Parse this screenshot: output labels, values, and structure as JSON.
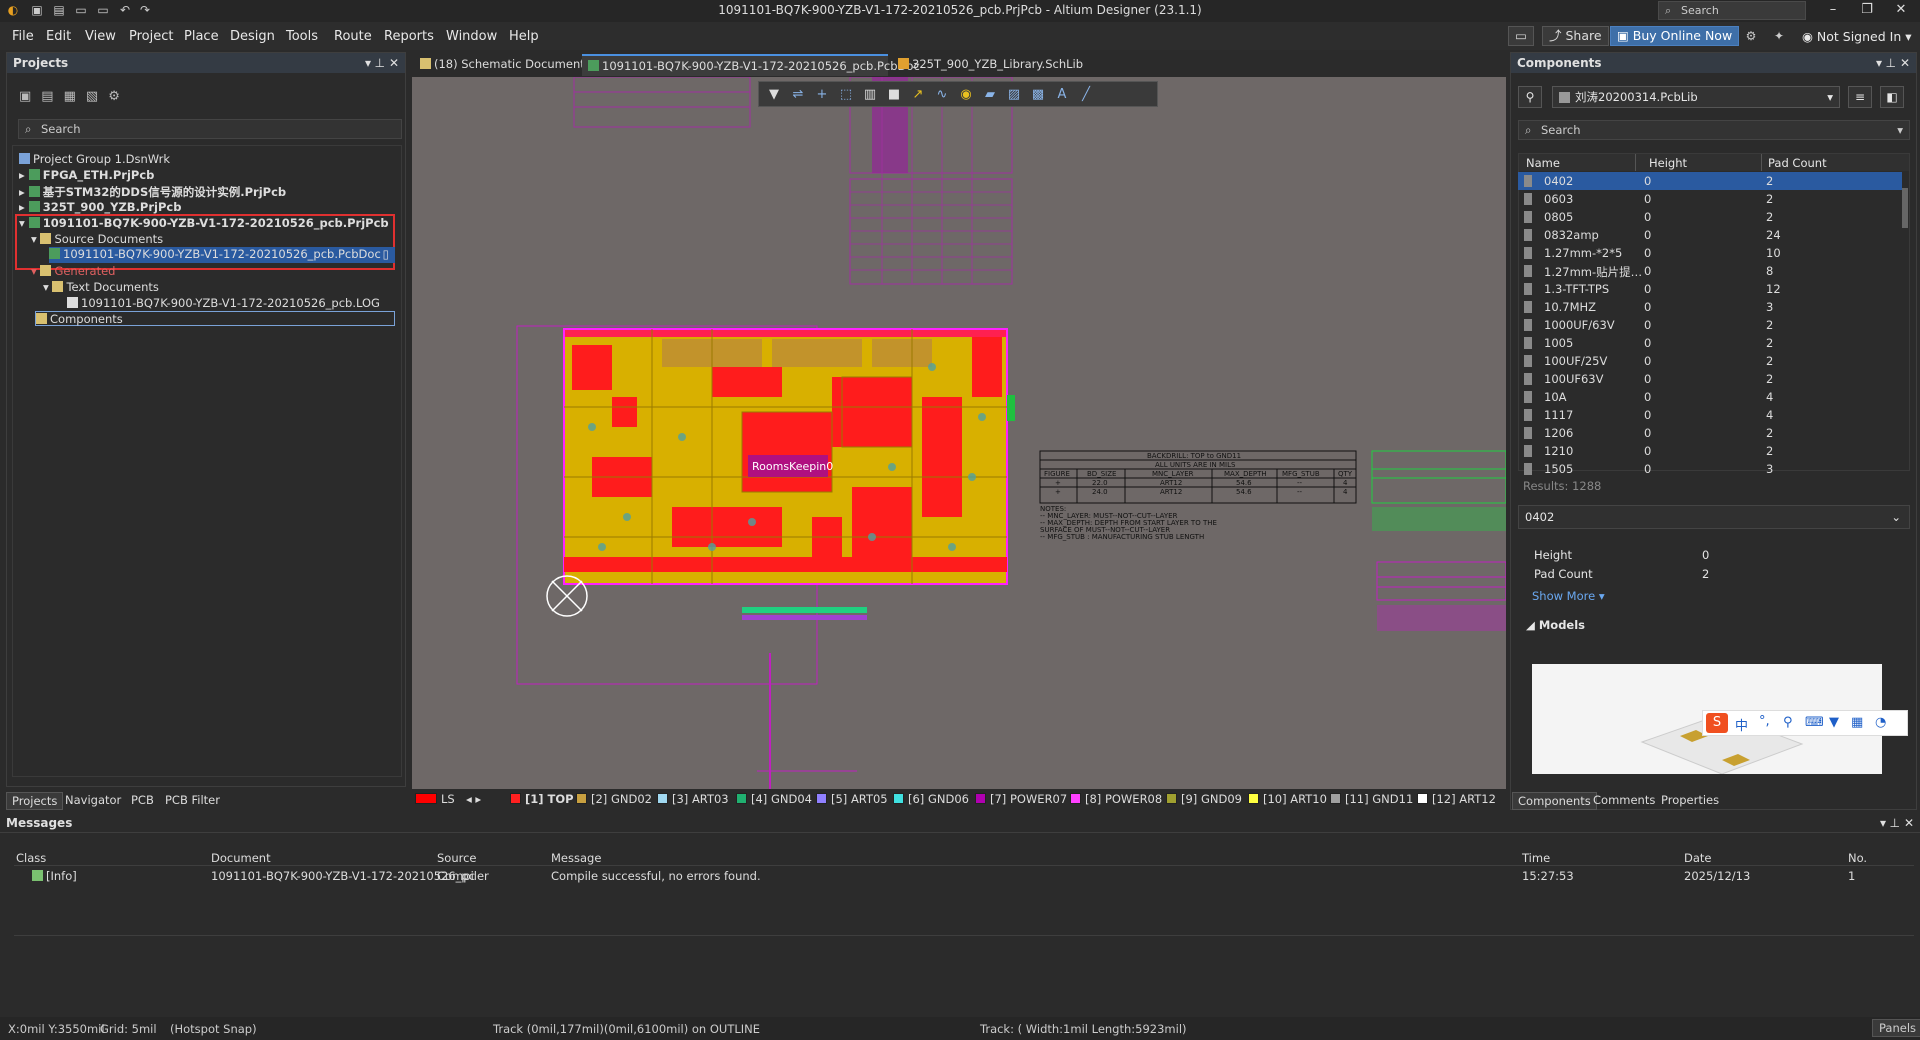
{
  "window": {
    "title": "1091101-BQ7K-900-YZB-V1-172-20210526_pcb.PrjPcb - Altium Designer (23.1.1)",
    "search_placeholder": "Search"
  },
  "menu": [
    "File",
    "Edit",
    "View",
    "Project",
    "Place",
    "Design",
    "Tools",
    "Route",
    "Reports",
    "Window",
    "Help"
  ],
  "menu_right": {
    "share": "Share",
    "buy": "Buy Online Now",
    "account": "Not Signed In"
  },
  "projects_panel": {
    "title": "Projects",
    "search_placeholder": "Search",
    "tree": [
      {
        "label": "Project Group 1.DsnWrk"
      },
      {
        "label": "FPGA_ETH.PrjPcb"
      },
      {
        "label": "基于STM32的DDS信号源的设计实例.PrjPcb"
      },
      {
        "label": "325T_900_YZB.PrjPcb"
      },
      {
        "label": "1091101-BQ7K-900-YZB-V1-172-20210526_pcb.PrjPcb"
      },
      {
        "label": "Source Documents"
      },
      {
        "label": "1091101-BQ7K-900-YZB-V1-172-20210526_pcb.PcbDoc"
      },
      {
        "label": "Generated"
      },
      {
        "label": "Text Documents"
      },
      {
        "label": "1091101-BQ7K-900-YZB-V1-172-20210526_pcb.LOG"
      },
      {
        "label": "Components"
      }
    ],
    "tabs": [
      "Projects",
      "Navigator",
      "PCB",
      "PCB Filter"
    ]
  },
  "doc_tabs": [
    "(18) Schematic Document",
    "1091101-BQ7K-900-YZB-V1-172-20210526_pcb.PcbDoc",
    "325T_900_YZB_Library.SchLib"
  ],
  "canvas": {
    "room_label": "RoomsKeepin0",
    "backdrill_title": "BACKDRILL: TOP to GND11",
    "backdrill_units": "ALL UNITS ARE IN MILS",
    "backdrill_headers": [
      "FIGURE",
      "BD_SIZE",
      "MNC_LAYER",
      "MAX_DEPTH",
      "MFG_STUB",
      "QTY"
    ],
    "backdrill_rows": [
      [
        "+",
        "22.0",
        "ART12",
        "54.6",
        "--",
        "4"
      ],
      [
        "+",
        "24.0",
        "ART12",
        "54.6",
        "--",
        "4"
      ]
    ],
    "notes": [
      "NOTES:",
      "-- MNC_LAYER: MUST--NOT--CUT--LAYER",
      "-- MAX_DEPTH: DEPTH FROM START LAYER TO THE",
      "SURFACE OF MUST--NOT--CUT--LAYER",
      "-- MFG_STUB : MANUFACTURING STUB LENGTH"
    ]
  },
  "layers": [
    {
      "name": "LS",
      "color": "#ff0000"
    },
    {
      "name": "[1] TOP",
      "color": "#ff2020"
    },
    {
      "name": "[2] GND02",
      "color": "#c8a040"
    },
    {
      "name": "[3] ART03",
      "color": "#a0d8f0"
    },
    {
      "name": "[4] GND04",
      "color": "#20b070"
    },
    {
      "name": "[5] ART05",
      "color": "#9080ff"
    },
    {
      "name": "[6] GND06",
      "color": "#40e0e0"
    },
    {
      "name": "[7] POWER07",
      "color": "#b000b0"
    },
    {
      "name": "[8] POWER08",
      "color": "#ff40ff"
    },
    {
      "name": "[9] GND09",
      "color": "#a0a030"
    },
    {
      "name": "[10] ART10",
      "color": "#ffff40"
    },
    {
      "name": "[11] GND11",
      "color": "#a0a0a0"
    },
    {
      "name": "[12] ART12",
      "color": "#ffffff"
    }
  ],
  "components_panel": {
    "title": "Components",
    "library": "刘涛20200314.PcbLib",
    "search_placeholder": "Search",
    "columns": [
      "Name",
      "Height",
      "Pad Count"
    ],
    "rows": [
      [
        "0402",
        "0",
        "2"
      ],
      [
        "0603",
        "0",
        "2"
      ],
      [
        "0805",
        "0",
        "2"
      ],
      [
        "0832amp",
        "0",
        "24"
      ],
      [
        "1.27mm-*2*5",
        "0",
        "10"
      ],
      [
        "1.27mm-贴片提…",
        "0",
        "8"
      ],
      [
        "1.3-TFT-TPS",
        "0",
        "12"
      ],
      [
        "10.7MHZ",
        "0",
        "3"
      ],
      [
        "1000UF/63V",
        "0",
        "2"
      ],
      [
        "1005",
        "0",
        "2"
      ],
      [
        "100UF/25V",
        "0",
        "2"
      ],
      [
        "100UF63V",
        "0",
        "2"
      ],
      [
        "10A",
        "0",
        "4"
      ],
      [
        "1117",
        "0",
        "4"
      ],
      [
        "1206",
        "0",
        "2"
      ],
      [
        "1210",
        "0",
        "2"
      ],
      [
        "1505",
        "0",
        "3"
      ]
    ],
    "results": "Results: 1288",
    "selected": "0402",
    "details": [
      [
        "Height",
        "0"
      ],
      [
        "Pad Count",
        "2"
      ]
    ],
    "show_more": "Show More",
    "models": "Models",
    "tabs": [
      "Components",
      "Comments",
      "Properties"
    ]
  },
  "messages": {
    "title": "Messages",
    "columns": [
      "Class",
      "Document",
      "Source",
      "Message",
      "Time",
      "Date",
      "No."
    ],
    "rows": [
      [
        "[Info]",
        "1091101-BQ7K-900-YZB-V1-172-20210526_pc",
        "Compiler",
        "Compile successful, no errors found.",
        "15:27:53",
        "2025/12/13",
        "1"
      ]
    ]
  },
  "status": {
    "coords": "X:0mil Y:3550mil",
    "grid": "Grid: 5mil",
    "snap": "(Hotspot Snap)",
    "track": "Track (0mil,177mil)(0mil,6100mil) on OUTLINE",
    "track2": "Track: ( Width:1mil Length:5923mil)",
    "panels": "Panels"
  }
}
